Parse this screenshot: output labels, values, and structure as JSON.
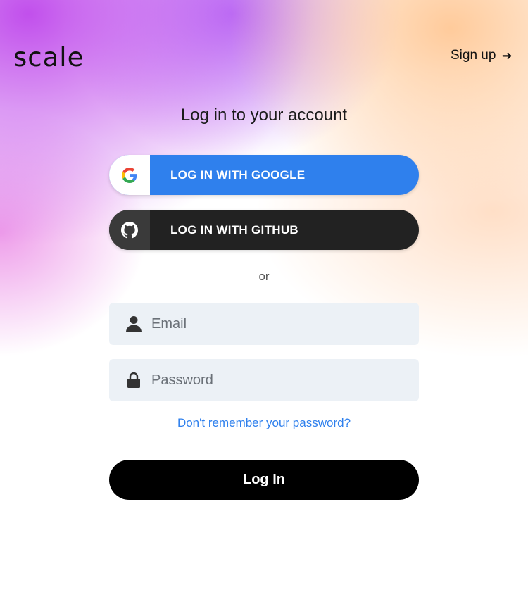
{
  "brand": {
    "logo_text": "scale"
  },
  "header": {
    "signup_label": "Sign up",
    "signup_arrow": "➜"
  },
  "page": {
    "title": "Log in to your account"
  },
  "oauth": {
    "google_label": "LOG IN WITH GOOGLE",
    "github_label": "LOG IN WITH GITHUB"
  },
  "divider": {
    "or_label": "or"
  },
  "form": {
    "email_placeholder": "Email",
    "email_value": "",
    "password_placeholder": "Password",
    "password_value": "",
    "forgot_label": "Don't remember your password?",
    "submit_label": "Log In"
  },
  "colors": {
    "google_blue": "#2f80ed",
    "github_dark": "#222222",
    "link_blue": "#2f80ed",
    "field_bg": "#ecf1f6",
    "submit_bg": "#000000"
  },
  "icons": {
    "google": "google-g-icon",
    "github": "github-icon",
    "user": "user-icon",
    "lock": "lock-icon",
    "arrow": "arrow-right-icon"
  }
}
